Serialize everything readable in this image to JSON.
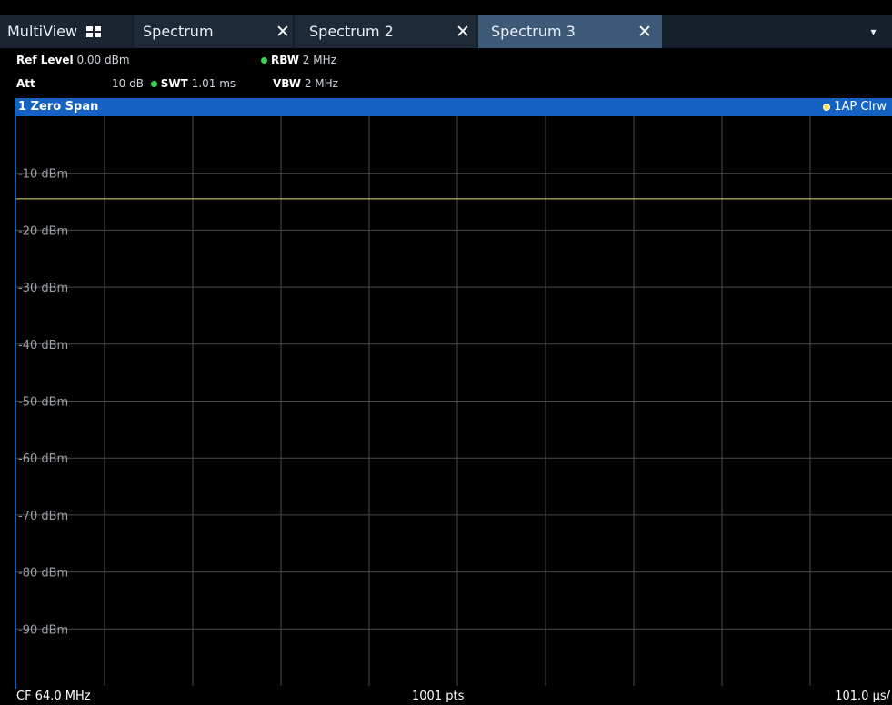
{
  "tabs": {
    "multiview": "MultiView",
    "items": [
      {
        "label": "Spectrum",
        "active": false
      },
      {
        "label": "Spectrum 2",
        "active": false
      },
      {
        "label": "Spectrum 3",
        "active": true
      }
    ],
    "dropdown": "▾"
  },
  "settings": {
    "ref_level_label": "Ref Level",
    "ref_level_value": "0.00 dBm",
    "att_label": "Att",
    "att_value": "10 dB",
    "swt_label": "SWT",
    "swt_value": "1.01 ms",
    "rbw_label": "RBW",
    "rbw_value": "2 MHz",
    "vbw_label": "VBW",
    "vbw_value": "2 MHz"
  },
  "window": {
    "title": "1 Zero Span",
    "trace_label": "1AP Clrw"
  },
  "chart_data": {
    "type": "line",
    "y_unit": "dBm",
    "ylim": [
      -100,
      0
    ],
    "y_tick_labels": [
      "-10 dBm",
      "-20 dBm",
      "-30 dBm",
      "-40 dBm",
      "-50 dBm",
      "-60 dBm",
      "-70 dBm",
      "-80 dBm",
      "-90 dBm"
    ],
    "y_ticks": [
      -10,
      -20,
      -30,
      -40,
      -50,
      -60,
      -70,
      -80,
      -90
    ],
    "x_divisions": 10,
    "grid": true,
    "series": [
      {
        "color": "#e8e46a",
        "values": [
          -14.5,
          -14.5
        ]
      }
    ]
  },
  "footer": {
    "center_freq": "CF 64.0 MHz",
    "points": "1001 pts",
    "time_per_div": "101.0 µs/"
  },
  "colors": {
    "accent": "#1562c3",
    "trace": "#e8e46a",
    "status_ok": "#39d353"
  }
}
